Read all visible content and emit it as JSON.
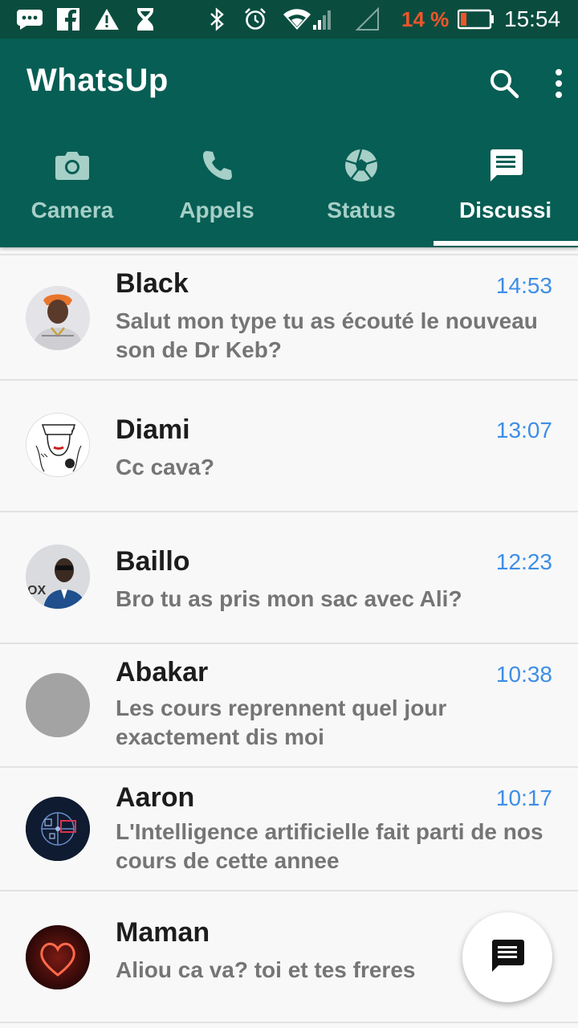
{
  "status_bar": {
    "battery_percent": "14 %",
    "time": "15:54",
    "battery_color": "#f0552b",
    "icons": [
      "message-icon",
      "facebook-icon",
      "warning-icon",
      "hourglass-icon",
      "bluetooth-icon",
      "alarm-icon",
      "wifi-icon",
      "signal-icon",
      "signal-empty-icon",
      "battery-icon"
    ]
  },
  "app_bar": {
    "title": "WhatsUp",
    "color": "#075e54"
  },
  "tabs": [
    {
      "label": "Camera",
      "icon": "camera-icon"
    },
    {
      "label": "Appels",
      "icon": "phone-icon"
    },
    {
      "label": "Status",
      "icon": "aperture-icon"
    },
    {
      "label": "Discussi",
      "icon": "chat-icon",
      "active": true
    }
  ],
  "chats": [
    {
      "name": "Black",
      "time": "14:53",
      "message": "Salut mon type tu as écouté le nouveau son de Dr Keb?"
    },
    {
      "name": "Diami",
      "time": "13:07",
      "message": "Cc cava?"
    },
    {
      "name": "Baillo",
      "time": "12:23",
      "message": "Bro tu as pris mon sac avec Ali?"
    },
    {
      "name": "Abakar",
      "time": "10:38",
      "message": "Les cours reprennent quel jour exactement dis moi"
    },
    {
      "name": "Aaron",
      "time": "10:17",
      "message": "L'Intelligence artificielle fait parti de nos cours de cette annee"
    },
    {
      "name": "Maman",
      "time": "",
      "message": "Aliou ca va? toi et tes freres"
    }
  ],
  "accent_time_color": "#3d8ee6",
  "fab": {
    "icon": "new-chat-icon"
  }
}
